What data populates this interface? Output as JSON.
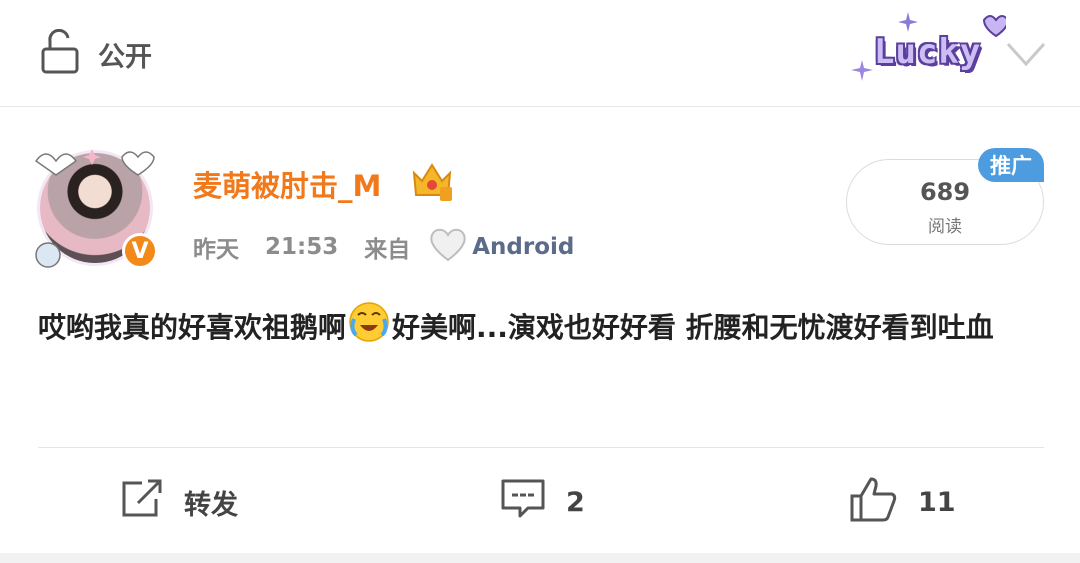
{
  "header": {
    "privacy_label": "公开",
    "lucky_text": "Lucky"
  },
  "post": {
    "username": "麦萌被肘击_M",
    "verified_badge": "V",
    "meta": {
      "date": "昨天",
      "time": "21:53",
      "source_prefix": "来自",
      "device": "Android"
    },
    "views": {
      "count": "689",
      "label": "阅读",
      "promo": "推广"
    },
    "content_part1": "哎哟我真的好喜欢祖鹅啊",
    "content_part2": "好美啊...演戏也好好看  折腰和无忧渡好看到吐血"
  },
  "actions": {
    "repost_label": "转发",
    "comment_count": "2",
    "like_count": "11"
  },
  "icons": {
    "privacy": "unlock-icon",
    "dropdown": "chevron-down-icon",
    "repost": "share-icon",
    "comment": "comment-icon",
    "like": "thumbs-up-icon",
    "emoji": "crying-laugh-emoji",
    "crown": "crown-icon",
    "heart": "heart-icon"
  },
  "colors": {
    "username": "#f2791b",
    "promo": "#4d9ce0",
    "device": "#5c6b8a",
    "verified": "#f28a1a"
  }
}
